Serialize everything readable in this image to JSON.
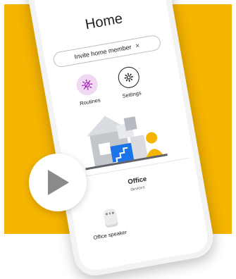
{
  "home": {
    "title": "Home",
    "invite_chip": "Invite home member",
    "close_glyph": "×"
  },
  "actions": [
    {
      "label": "Routines",
      "icon": "routines-icon"
    },
    {
      "label": "Settings",
      "icon": "gear-icon"
    }
  ],
  "room": {
    "name": "Office",
    "subtitle": "devices"
  },
  "device": {
    "label": "Office speaker",
    "icon": "speaker-icon"
  },
  "play_button": {
    "icon": "play-icon"
  },
  "colors": {
    "background": "#f5b400",
    "routines_bg": "#f1d8f3",
    "routines_icon": "#9c27b0",
    "house_blue": "#1a73e8",
    "person_yellow": "#f5b400"
  }
}
